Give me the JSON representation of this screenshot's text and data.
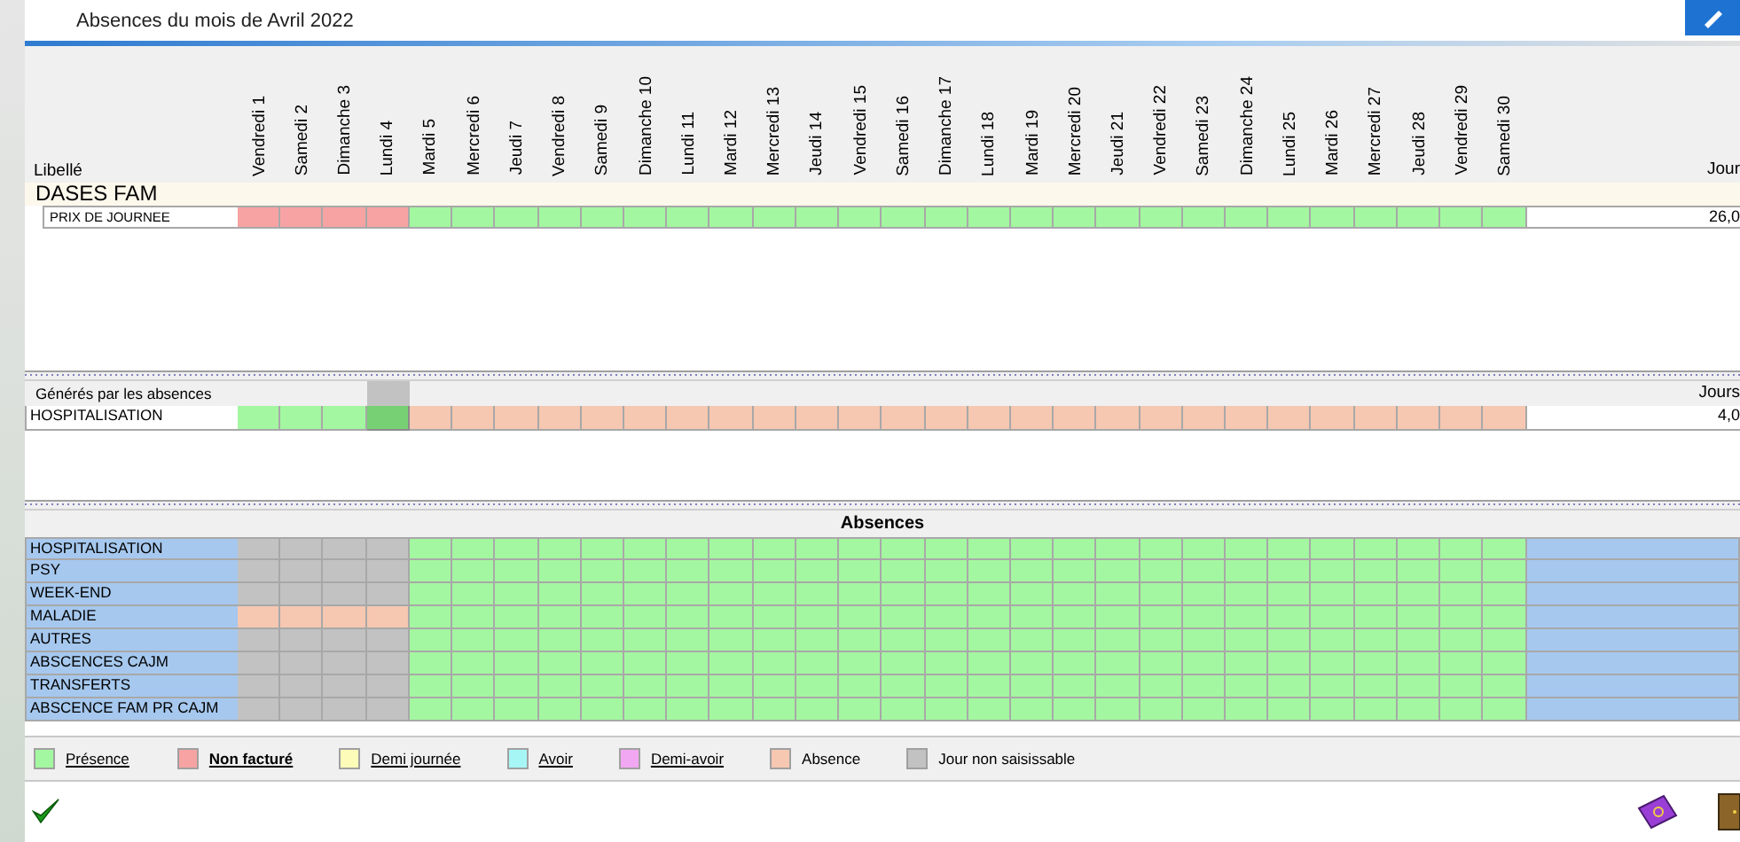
{
  "window": {
    "title": "Absences du mois de Avril 2022"
  },
  "days": [
    "Vendredi 1",
    "Samedi 2",
    "Dimanche 3",
    "Lundi 4",
    "Mardi 5",
    "Mercredi 6",
    "Jeudi 7",
    "Vendredi 8",
    "Samedi 9",
    "Dimanche 10",
    "Lundi 11",
    "Mardi 12",
    "Mercredi 13",
    "Jeudi 14",
    "Vendredi 15",
    "Samedi 16",
    "Dimanche 17",
    "Lundi 18",
    "Mardi 19",
    "Mercredi 20",
    "Jeudi 21",
    "Vendredi 22",
    "Samedi 23",
    "Dimanche 24",
    "Lundi 25",
    "Mardi 26",
    "Mercredi 27",
    "Jeudi 28",
    "Vendredi 29",
    "Samedi 30"
  ],
  "billing": {
    "label_header": "Libellé",
    "total_header": "Jour",
    "group": "DASES FAM",
    "rows": [
      {
        "label": "PRIX DE JOURNEE",
        "total": "26,0",
        "cells": [
          {
            "kind": "nonfacture"
          },
          {
            "kind": "nonfacture"
          },
          {
            "kind": "nonfacture"
          },
          {
            "kind": "nonfacture"
          },
          {
            "kind": "presence"
          },
          {
            "kind": "presence"
          },
          {
            "kind": "presence"
          },
          {
            "kind": "presence"
          },
          {
            "kind": "presence"
          },
          {
            "kind": "presence"
          },
          {
            "kind": "presence"
          },
          {
            "kind": "presence"
          },
          {
            "kind": "presence"
          },
          {
            "kind": "presence"
          },
          {
            "kind": "presence"
          },
          {
            "kind": "presence"
          },
          {
            "kind": "presence"
          },
          {
            "kind": "presence"
          },
          {
            "kind": "presence"
          },
          {
            "kind": "presence"
          },
          {
            "kind": "presence"
          },
          {
            "kind": "presence"
          },
          {
            "kind": "presence"
          },
          {
            "kind": "presence"
          },
          {
            "kind": "presence"
          },
          {
            "kind": "presence"
          },
          {
            "kind": "presence"
          },
          {
            "kind": "presence"
          },
          {
            "kind": "presence"
          },
          {
            "kind": "presence"
          }
        ]
      }
    ]
  },
  "generated": {
    "title": "Générés par les absences",
    "total_header": "Jours",
    "rows": [
      {
        "label": "HOSPITALISATION",
        "total": "4,0",
        "cells": [
          {
            "kind": "presence",
            "selected": false
          },
          {
            "kind": "presence",
            "selected": false
          },
          {
            "kind": "presence",
            "selected": false
          },
          {
            "kind": "presence",
            "selected": true
          },
          {
            "kind": "absence",
            "selected": false
          },
          {
            "kind": "absence",
            "selected": false
          },
          {
            "kind": "absence",
            "selected": false
          },
          {
            "kind": "absence",
            "selected": false
          },
          {
            "kind": "absence",
            "selected": false
          },
          {
            "kind": "absence",
            "selected": false
          },
          {
            "kind": "absence",
            "selected": false
          },
          {
            "kind": "absence",
            "selected": false
          },
          {
            "kind": "absence",
            "selected": false
          },
          {
            "kind": "absence",
            "selected": false
          },
          {
            "kind": "absence",
            "selected": false
          },
          {
            "kind": "absence",
            "selected": false
          },
          {
            "kind": "absence",
            "selected": false
          },
          {
            "kind": "absence",
            "selected": false
          },
          {
            "kind": "absence",
            "selected": false
          },
          {
            "kind": "absence",
            "selected": false
          },
          {
            "kind": "absence",
            "selected": false
          },
          {
            "kind": "absence",
            "selected": false
          },
          {
            "kind": "absence",
            "selected": false
          },
          {
            "kind": "absence",
            "selected": false
          },
          {
            "kind": "absence",
            "selected": false
          },
          {
            "kind": "absence",
            "selected": false
          },
          {
            "kind": "absence",
            "selected": false
          },
          {
            "kind": "absence",
            "selected": false
          },
          {
            "kind": "absence",
            "selected": false
          },
          {
            "kind": "absence",
            "selected": false
          }
        ]
      }
    ]
  },
  "absences": {
    "title": "Absences",
    "rows": [
      {
        "label": "HOSPITALISATION",
        "cells": [
          {
            "kind": "locked"
          },
          {
            "kind": "locked"
          },
          {
            "kind": "locked"
          },
          {
            "kind": "locked"
          },
          {
            "kind": "presence"
          },
          {
            "kind": "presence"
          },
          {
            "kind": "presence"
          },
          {
            "kind": "presence"
          },
          {
            "kind": "presence"
          },
          {
            "kind": "presence"
          },
          {
            "kind": "presence"
          },
          {
            "kind": "presence"
          },
          {
            "kind": "presence"
          },
          {
            "kind": "presence"
          },
          {
            "kind": "presence"
          },
          {
            "kind": "presence"
          },
          {
            "kind": "presence"
          },
          {
            "kind": "presence"
          },
          {
            "kind": "presence"
          },
          {
            "kind": "presence"
          },
          {
            "kind": "presence"
          },
          {
            "kind": "presence"
          },
          {
            "kind": "presence"
          },
          {
            "kind": "presence"
          },
          {
            "kind": "presence"
          },
          {
            "kind": "presence"
          },
          {
            "kind": "presence"
          },
          {
            "kind": "presence"
          },
          {
            "kind": "presence"
          },
          {
            "kind": "presence"
          }
        ]
      },
      {
        "label": "PSY",
        "cells": [
          {
            "kind": "locked"
          },
          {
            "kind": "locked"
          },
          {
            "kind": "locked"
          },
          {
            "kind": "locked"
          },
          {
            "kind": "presence"
          },
          {
            "kind": "presence"
          },
          {
            "kind": "presence"
          },
          {
            "kind": "presence"
          },
          {
            "kind": "presence"
          },
          {
            "kind": "presence"
          },
          {
            "kind": "presence"
          },
          {
            "kind": "presence"
          },
          {
            "kind": "presence"
          },
          {
            "kind": "presence"
          },
          {
            "kind": "presence"
          },
          {
            "kind": "presence"
          },
          {
            "kind": "presence"
          },
          {
            "kind": "presence"
          },
          {
            "kind": "presence"
          },
          {
            "kind": "presence"
          },
          {
            "kind": "presence"
          },
          {
            "kind": "presence"
          },
          {
            "kind": "presence"
          },
          {
            "kind": "presence"
          },
          {
            "kind": "presence"
          },
          {
            "kind": "presence"
          },
          {
            "kind": "presence"
          },
          {
            "kind": "presence"
          },
          {
            "kind": "presence"
          },
          {
            "kind": "presence"
          }
        ]
      },
      {
        "label": "WEEK-END",
        "cells": [
          {
            "kind": "locked"
          },
          {
            "kind": "locked"
          },
          {
            "kind": "locked"
          },
          {
            "kind": "locked"
          },
          {
            "kind": "presence"
          },
          {
            "kind": "presence"
          },
          {
            "kind": "presence"
          },
          {
            "kind": "presence"
          },
          {
            "kind": "presence"
          },
          {
            "kind": "presence"
          },
          {
            "kind": "presence"
          },
          {
            "kind": "presence"
          },
          {
            "kind": "presence"
          },
          {
            "kind": "presence"
          },
          {
            "kind": "presence"
          },
          {
            "kind": "presence"
          },
          {
            "kind": "presence"
          },
          {
            "kind": "presence"
          },
          {
            "kind": "presence"
          },
          {
            "kind": "presence"
          },
          {
            "kind": "presence"
          },
          {
            "kind": "presence"
          },
          {
            "kind": "presence"
          },
          {
            "kind": "presence"
          },
          {
            "kind": "presence"
          },
          {
            "kind": "presence"
          },
          {
            "kind": "presence"
          },
          {
            "kind": "presence"
          },
          {
            "kind": "presence"
          },
          {
            "kind": "presence"
          }
        ]
      },
      {
        "label": "MALADIE",
        "cells": [
          {
            "kind": "absence"
          },
          {
            "kind": "absence"
          },
          {
            "kind": "absence"
          },
          {
            "kind": "absence"
          },
          {
            "kind": "presence"
          },
          {
            "kind": "presence"
          },
          {
            "kind": "presence"
          },
          {
            "kind": "presence"
          },
          {
            "kind": "presence"
          },
          {
            "kind": "presence"
          },
          {
            "kind": "presence"
          },
          {
            "kind": "presence"
          },
          {
            "kind": "presence"
          },
          {
            "kind": "presence"
          },
          {
            "kind": "presence"
          },
          {
            "kind": "presence"
          },
          {
            "kind": "presence"
          },
          {
            "kind": "presence"
          },
          {
            "kind": "presence"
          },
          {
            "kind": "presence"
          },
          {
            "kind": "presence"
          },
          {
            "kind": "presence"
          },
          {
            "kind": "presence"
          },
          {
            "kind": "presence"
          },
          {
            "kind": "presence"
          },
          {
            "kind": "presence"
          },
          {
            "kind": "presence"
          },
          {
            "kind": "presence"
          },
          {
            "kind": "presence"
          },
          {
            "kind": "presence"
          }
        ]
      },
      {
        "label": "AUTRES",
        "cells": [
          {
            "kind": "locked"
          },
          {
            "kind": "locked"
          },
          {
            "kind": "locked"
          },
          {
            "kind": "locked"
          },
          {
            "kind": "presence"
          },
          {
            "kind": "presence"
          },
          {
            "kind": "presence"
          },
          {
            "kind": "presence"
          },
          {
            "kind": "presence"
          },
          {
            "kind": "presence"
          },
          {
            "kind": "presence"
          },
          {
            "kind": "presence"
          },
          {
            "kind": "presence"
          },
          {
            "kind": "presence"
          },
          {
            "kind": "presence"
          },
          {
            "kind": "presence"
          },
          {
            "kind": "presence"
          },
          {
            "kind": "presence"
          },
          {
            "kind": "presence"
          },
          {
            "kind": "presence"
          },
          {
            "kind": "presence"
          },
          {
            "kind": "presence"
          },
          {
            "kind": "presence"
          },
          {
            "kind": "presence"
          },
          {
            "kind": "presence"
          },
          {
            "kind": "presence"
          },
          {
            "kind": "presence"
          },
          {
            "kind": "presence"
          },
          {
            "kind": "presence"
          },
          {
            "kind": "presence"
          }
        ]
      },
      {
        "label": "ABSCENCES CAJM",
        "cells": [
          {
            "kind": "locked"
          },
          {
            "kind": "locked"
          },
          {
            "kind": "locked"
          },
          {
            "kind": "locked"
          },
          {
            "kind": "presence"
          },
          {
            "kind": "presence"
          },
          {
            "kind": "presence"
          },
          {
            "kind": "presence"
          },
          {
            "kind": "presence"
          },
          {
            "kind": "presence"
          },
          {
            "kind": "presence"
          },
          {
            "kind": "presence"
          },
          {
            "kind": "presence"
          },
          {
            "kind": "presence"
          },
          {
            "kind": "presence"
          },
          {
            "kind": "presence"
          },
          {
            "kind": "presence"
          },
          {
            "kind": "presence"
          },
          {
            "kind": "presence"
          },
          {
            "kind": "presence"
          },
          {
            "kind": "presence"
          },
          {
            "kind": "presence"
          },
          {
            "kind": "presence"
          },
          {
            "kind": "presence"
          },
          {
            "kind": "presence"
          },
          {
            "kind": "presence"
          },
          {
            "kind": "presence"
          },
          {
            "kind": "presence"
          },
          {
            "kind": "presence"
          },
          {
            "kind": "presence"
          }
        ]
      },
      {
        "label": "TRANSFERTS",
        "cells": [
          {
            "kind": "locked"
          },
          {
            "kind": "locked"
          },
          {
            "kind": "locked"
          },
          {
            "kind": "locked"
          },
          {
            "kind": "presence"
          },
          {
            "kind": "presence"
          },
          {
            "kind": "presence"
          },
          {
            "kind": "presence"
          },
          {
            "kind": "presence"
          },
          {
            "kind": "presence"
          },
          {
            "kind": "presence"
          },
          {
            "kind": "presence"
          },
          {
            "kind": "presence"
          },
          {
            "kind": "presence"
          },
          {
            "kind": "presence"
          },
          {
            "kind": "presence"
          },
          {
            "kind": "presence"
          },
          {
            "kind": "presence"
          },
          {
            "kind": "presence"
          },
          {
            "kind": "presence"
          },
          {
            "kind": "presence"
          },
          {
            "kind": "presence"
          },
          {
            "kind": "presence"
          },
          {
            "kind": "presence"
          },
          {
            "kind": "presence"
          },
          {
            "kind": "presence"
          },
          {
            "kind": "presence"
          },
          {
            "kind": "presence"
          },
          {
            "kind": "presence"
          },
          {
            "kind": "presence"
          }
        ]
      },
      {
        "label": "ABSCENCE FAM PR CAJM",
        "cells": [
          {
            "kind": "locked"
          },
          {
            "kind": "locked"
          },
          {
            "kind": "locked"
          },
          {
            "kind": "locked"
          },
          {
            "kind": "presence"
          },
          {
            "kind": "presence"
          },
          {
            "kind": "presence"
          },
          {
            "kind": "presence"
          },
          {
            "kind": "presence"
          },
          {
            "kind": "presence"
          },
          {
            "kind": "presence"
          },
          {
            "kind": "presence"
          },
          {
            "kind": "presence"
          },
          {
            "kind": "presence"
          },
          {
            "kind": "presence"
          },
          {
            "kind": "presence"
          },
          {
            "kind": "presence"
          },
          {
            "kind": "presence"
          },
          {
            "kind": "presence"
          },
          {
            "kind": "presence"
          },
          {
            "kind": "presence"
          },
          {
            "kind": "presence"
          },
          {
            "kind": "presence"
          },
          {
            "kind": "presence"
          },
          {
            "kind": "presence"
          },
          {
            "kind": "presence"
          },
          {
            "kind": "presence"
          },
          {
            "kind": "presence"
          },
          {
            "kind": "presence"
          },
          {
            "kind": "presence"
          }
        ]
      }
    ]
  },
  "legend": [
    {
      "label": "Présence",
      "color": "#a3f7a0",
      "underlined": true,
      "bold": false
    },
    {
      "label": "Non facturé",
      "color": "#f7a3a3",
      "underlined": true,
      "bold": true
    },
    {
      "label": "Demi journée",
      "color": "#fdfdb9",
      "underlined": true,
      "bold": false
    },
    {
      "label": "Avoir",
      "color": "#a7f6f6",
      "underlined": true,
      "bold": false
    },
    {
      "label": "Demi-avoir",
      "color": "#f1a7f1",
      "underlined": true,
      "bold": false
    },
    {
      "label": "Absence",
      "color": "#f6c7b1",
      "underlined": false,
      "bold": false
    },
    {
      "label": "Jour non saisissable",
      "color": "#c2c2c2",
      "underlined": false,
      "bold": false
    }
  ]
}
